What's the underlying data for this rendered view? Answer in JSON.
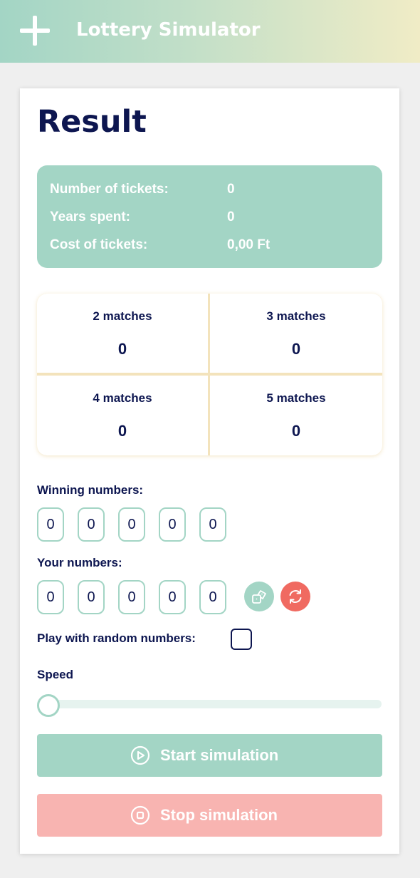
{
  "app": {
    "title": "Lottery Simulator"
  },
  "result": {
    "heading": "Result",
    "stats": [
      {
        "label": "Number of tickets:",
        "value": "0"
      },
      {
        "label": "Years spent:",
        "value": "0"
      },
      {
        "label": "Cost of tickets:",
        "value": "0,00 Ft"
      }
    ],
    "matches": [
      {
        "label": "2 matches",
        "value": "0"
      },
      {
        "label": "3 matches",
        "value": "0"
      },
      {
        "label": "4 matches",
        "value": "0"
      },
      {
        "label": "5 matches",
        "value": "0"
      }
    ]
  },
  "winning": {
    "label": "Winning numbers:",
    "numbers": [
      "0",
      "0",
      "0",
      "0",
      "0"
    ]
  },
  "yours": {
    "label": "Your numbers:",
    "numbers": [
      "0",
      "0",
      "0",
      "0",
      "0"
    ]
  },
  "random": {
    "label": "Play with random numbers:",
    "checked": false
  },
  "speed": {
    "label": "Speed",
    "value": 0
  },
  "buttons": {
    "start_label": "Start simulation",
    "stop_label": "Stop simulation",
    "start_icon": "play-circle-icon",
    "stop_icon": "stop-circle-icon",
    "random_icon": "dice-icon",
    "reset_icon": "refresh-icon"
  },
  "colors": {
    "accent_teal": "#a3d5c5",
    "danger_red": "#f06a61",
    "stop_pink": "#f8b4b1",
    "text_navy": "#0d1650"
  }
}
